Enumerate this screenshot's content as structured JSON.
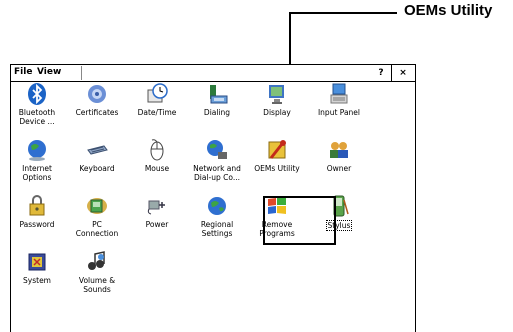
{
  "callout": {
    "label": "OEMs Utility"
  },
  "window": {
    "menu": [
      {
        "label": "File",
        "underline": "F"
      },
      {
        "label": "View",
        "underline": "V"
      }
    ],
    "help_button": "?",
    "close_button": "×"
  },
  "items": [
    {
      "label": "Bluetooth\nDevice ...",
      "icon": "bluetooth-icon"
    },
    {
      "label": "Certificates",
      "icon": "certificates-icon"
    },
    {
      "label": "Date/Time",
      "icon": "date-time-icon"
    },
    {
      "label": "Dialing",
      "icon": "dialing-icon"
    },
    {
      "label": "Display",
      "icon": "display-icon"
    },
    {
      "label": "Input Panel",
      "icon": "input-panel-icon"
    },
    {
      "label": "Internet\nOptions",
      "icon": "internet-options-icon"
    },
    {
      "label": "Keyboard",
      "icon": "keyboard-icon"
    },
    {
      "label": "Mouse",
      "icon": "mouse-icon"
    },
    {
      "label": "Network and\nDial-up Co...",
      "icon": "network-icon"
    },
    {
      "label": "OEMs Utility",
      "icon": "oems-utility-icon"
    },
    {
      "label": "Owner",
      "icon": "owner-icon"
    },
    {
      "label": "Password",
      "icon": "password-icon"
    },
    {
      "label": "PC\nConnection",
      "icon": "pc-connection-icon"
    },
    {
      "label": "Power",
      "icon": "power-icon"
    },
    {
      "label": "Regional\nSettings",
      "icon": "regional-settings-icon"
    },
    {
      "label": "Remove\nPrograms",
      "icon": "remove-programs-icon"
    },
    {
      "label": "Stylus",
      "icon": "stylus-icon"
    },
    {
      "label": "System",
      "icon": "system-icon"
    },
    {
      "label": "Volume &\nSounds",
      "icon": "volume-sounds-icon"
    }
  ]
}
